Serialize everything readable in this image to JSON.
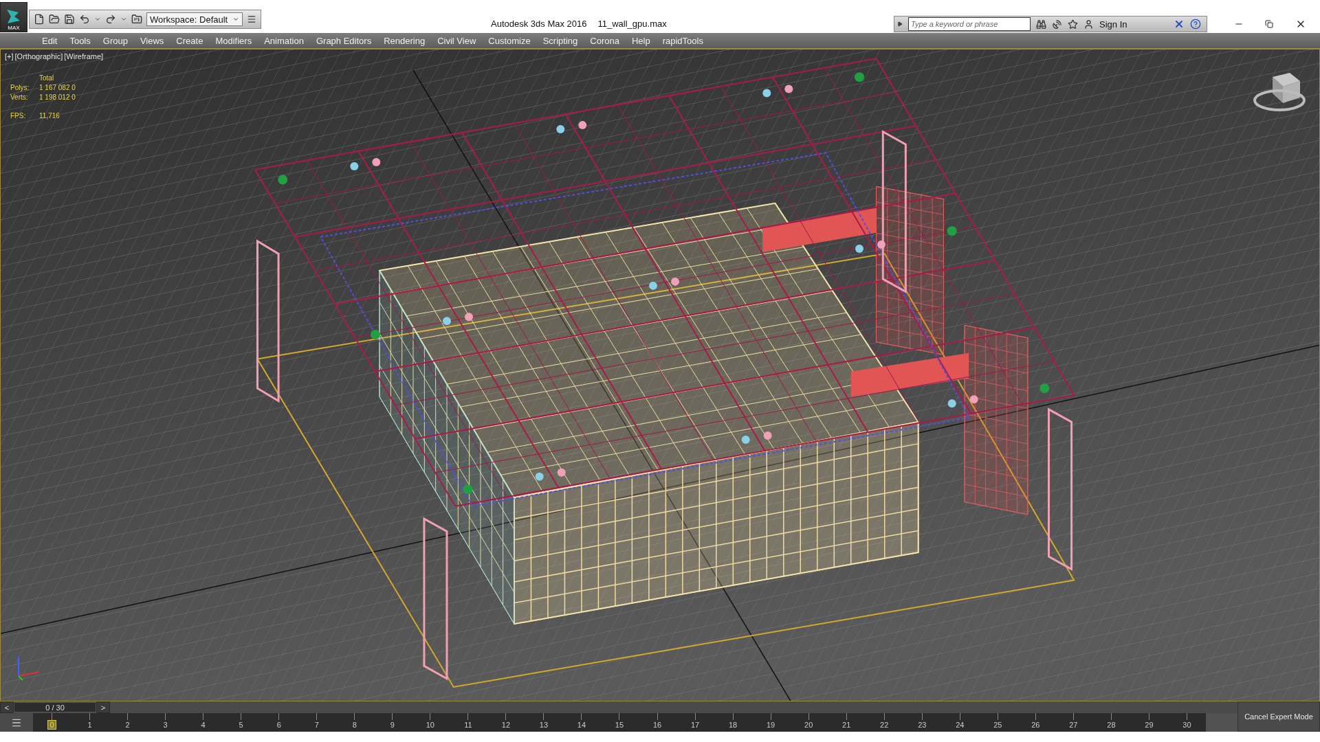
{
  "app_logo": {
    "label": "MAX"
  },
  "quick_access": {
    "workspace": "Workspace: Default"
  },
  "window": {
    "title": "Autodesk 3ds Max 2016",
    "file": "11_wall_gpu.max"
  },
  "info_center": {
    "placeholder": "Type a keyword or phrase",
    "sign_in": "Sign In"
  },
  "menu": [
    "Edit",
    "Tools",
    "Group",
    "Views",
    "Create",
    "Modifiers",
    "Animation",
    "Graph Editors",
    "Rendering",
    "Civil View",
    "Customize",
    "Scripting",
    "Corona",
    "Help",
    "rapidTools"
  ],
  "viewport": {
    "labels": [
      "[+]",
      "[Orthographic]",
      "[Wireframe]"
    ],
    "stats": {
      "header": "Total",
      "rows": [
        {
          "label": "Polys:",
          "total": "1 167 082",
          "selected": "0"
        },
        {
          "label": "Verts:",
          "total": "1 198 012",
          "selected": "0"
        }
      ],
      "fps_label": "FPS:",
      "fps": "11,716"
    }
  },
  "time_slider": {
    "prev": "<",
    "frame": "0 / 30",
    "next": ">"
  },
  "track_bar": {
    "ticks": [
      {
        "label": "0",
        "selected": true
      },
      {
        "label": "1",
        "selected": false
      },
      {
        "label": "2",
        "selected": false
      },
      {
        "label": "3",
        "selected": false
      },
      {
        "label": "4",
        "selected": false
      },
      {
        "label": "5",
        "selected": false
      },
      {
        "label": "6",
        "selected": false
      },
      {
        "label": "7",
        "selected": false
      },
      {
        "label": "8",
        "selected": false
      },
      {
        "label": "9",
        "selected": false
      },
      {
        "label": "10",
        "selected": false
      },
      {
        "label": "11",
        "selected": false
      },
      {
        "label": "12",
        "selected": false
      },
      {
        "label": "13",
        "selected": false
      },
      {
        "label": "14",
        "selected": false
      },
      {
        "label": "15",
        "selected": false
      },
      {
        "label": "16",
        "selected": false
      },
      {
        "label": "17",
        "selected": false
      },
      {
        "label": "18",
        "selected": false
      },
      {
        "label": "19",
        "selected": false
      },
      {
        "label": "20",
        "selected": false
      },
      {
        "label": "21",
        "selected": false
      },
      {
        "label": "22",
        "selected": false
      },
      {
        "label": "23",
        "selected": false
      },
      {
        "label": "24",
        "selected": false
      },
      {
        "label": "25",
        "selected": false
      },
      {
        "label": "26",
        "selected": false
      },
      {
        "label": "27",
        "selected": false
      },
      {
        "label": "28",
        "selected": false
      },
      {
        "label": "29",
        "selected": false
      },
      {
        "label": "30",
        "selected": false
      }
    ]
  },
  "expert_mode_button": "Cancel Expert Mode"
}
